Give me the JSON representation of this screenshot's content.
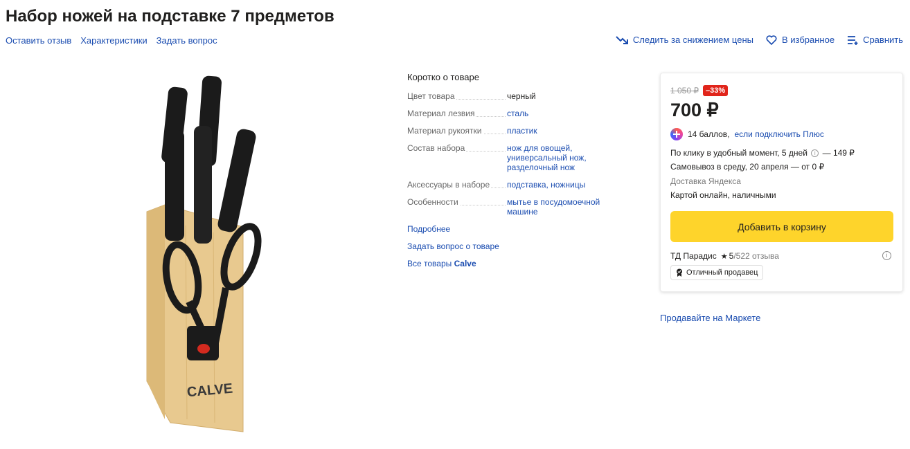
{
  "product": {
    "title": "Набор ножей на подставке 7 предметов"
  },
  "subnav": {
    "review": "Оставить отзыв",
    "specs": "Характеристики",
    "question": "Задать вопрос"
  },
  "actions": {
    "price_watch": "Следить за снижением цены",
    "favorite": "В избранное",
    "compare": "Сравнить"
  },
  "image": {
    "brand_logo": "CALVE"
  },
  "specs": {
    "title": "Коротко о товаре",
    "rows": [
      {
        "key": "Цвет товара",
        "value": "черный"
      },
      {
        "key": "Материал лезвия",
        "value": "сталь"
      },
      {
        "key": "Материал рукоятки",
        "value": "пластик"
      },
      {
        "key": "Состав набора",
        "value": "нож для овощей, универсальный нож, разделочный нож"
      },
      {
        "key": "Аксессуары в наборе",
        "value": "подставка, ножницы"
      },
      {
        "key": "Особенности",
        "value": "мытье в посудомоечной машине"
      }
    ],
    "more": "Подробнее",
    "ask": "Задать вопрос о товаре",
    "all_goods_prefix": "Все товары",
    "brand": "Calve"
  },
  "offer": {
    "old_price": "1 050 ₽",
    "discount": "–33%",
    "price": "700 ₽",
    "plus_points": "14 баллов,",
    "plus_link": "если подключить Плюс",
    "delivery_line1_a": "По клику в удобный момент, 5 дней",
    "delivery_line1_b": "— 149 ₽",
    "delivery_line2": "Самовывоз в среду, 20 апреля — от 0 ₽",
    "delivery_service": "Доставка Яндекса",
    "payment": "Картой онлайн, наличными",
    "cart_button": "Добавить в корзину",
    "seller": "ТД Парадис",
    "rating": "5",
    "reviews": "/522 отзыва",
    "seller_badge": "Отличный продавец"
  },
  "sell_link": "Продавайте на Маркете",
  "colors": {
    "link": "#1a4cb0",
    "cart_button": "#fed42b",
    "discount": "#e1251b"
  }
}
